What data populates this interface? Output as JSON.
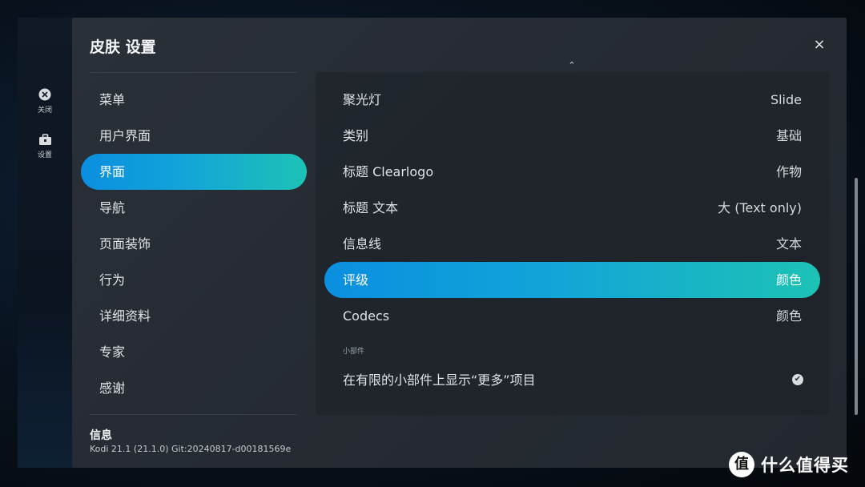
{
  "side_rail": {
    "close_label": "关闭",
    "settings_label": "设置"
  },
  "dialog": {
    "title": "皮肤 设置",
    "close_glyph": "×"
  },
  "menu": {
    "items": [
      {
        "label": "菜单"
      },
      {
        "label": "用户界面"
      },
      {
        "label": "界面"
      },
      {
        "label": "导航"
      },
      {
        "label": "页面装饰"
      },
      {
        "label": "行为"
      },
      {
        "label": "详细资料"
      },
      {
        "label": "专家"
      },
      {
        "label": "感谢"
      }
    ],
    "active_index": 2
  },
  "info": {
    "title": "信息",
    "version": "Kodi 21.1 (21.1.0) Git:20240817-d00181569e"
  },
  "panel": {
    "scroll_up_glyph": "⌃",
    "rows": [
      {
        "label": "聚光灯",
        "value": "Slide"
      },
      {
        "label": "类别",
        "value": "基础"
      },
      {
        "label": "标题 Clearlogo",
        "value": "作物"
      },
      {
        "label": "标题 文本",
        "value": "大 (Text only)"
      },
      {
        "label": "信息线",
        "value": "文本"
      },
      {
        "label": "评级",
        "value": "颜色"
      },
      {
        "label": "Codecs",
        "value": "颜色"
      }
    ],
    "active_row_index": 5,
    "section_header": "小部件",
    "toggle_row": {
      "label": "在有限的小部件上显示“更多”项目",
      "checked": true
    }
  },
  "watermark": {
    "logo_glyph": "值",
    "text": "什么值得买"
  },
  "colors": {
    "accent_start": "#0b8fe0",
    "accent_end": "#1dc2b6",
    "dialog_bg": "#272c34"
  }
}
